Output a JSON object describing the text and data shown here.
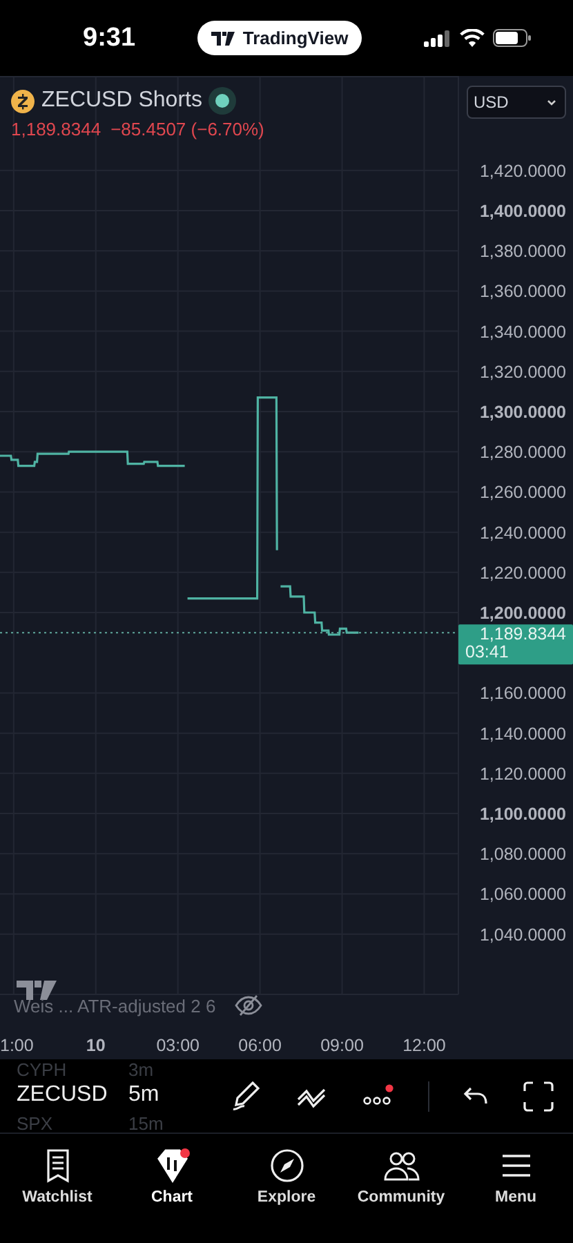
{
  "status_bar": {
    "time": "9:31",
    "app_pill": "TradingView"
  },
  "header": {
    "symbol": "ZECUSD Shorts",
    "last": "1,189.8344",
    "change": "−85.4507 (−6.70%)",
    "currency": "USD"
  },
  "price_tag": {
    "price": "1,189.8344",
    "countdown": "03:41"
  },
  "indicator": {
    "label": "Weis ... ATR-adjusted 2 6"
  },
  "time_axis": [
    "1:00",
    "10"
  ],
  "chart_data": {
    "type": "line",
    "grid": true,
    "ylim": [
      1010,
      1467
    ],
    "xlim": [
      -3.5,
      13.25
    ],
    "xticks": [
      {
        "value": 3,
        "label": "03:00"
      },
      {
        "value": 6,
        "label": "06:00"
      },
      {
        "value": 9,
        "label": "09:00"
      },
      {
        "value": 12,
        "label": "12:00"
      }
    ],
    "x": [
      -3.5,
      -3.1,
      -3.08,
      -2.85,
      -2.83,
      -2.25,
      -2.23,
      -2.15,
      -2.13,
      -1,
      -0.98,
      1.15,
      1.17,
      1.75,
      1.77,
      2.25,
      2.27,
      3.25,
      3.3,
      3.35,
      5.9,
      5.92,
      6.6,
      6.62,
      6.7,
      6.75,
      7.1,
      7.12,
      7.6,
      7.62,
      8,
      8.02,
      8.25,
      8.27,
      8.5,
      8.52,
      8.9,
      8.92,
      9.15,
      9.17,
      9.6,
      13.25
    ],
    "series": [
      {
        "color": "#4fb3a3",
        "values": [
          1278,
          1278,
          1276,
          1276,
          1273,
          1273,
          1275,
          1275,
          1279,
          1279,
          1280,
          1280,
          1274,
          1274,
          1275,
          1275,
          1273,
          1273,
          null,
          1207,
          1207,
          1307,
          1307,
          1231,
          null,
          1213,
          1213,
          1208,
          1208,
          1200,
          1200,
          1195,
          1195,
          1191,
          1191,
          1189,
          1189,
          1192,
          1192,
          1190,
          1190,
          null
        ]
      },
      {
        "color": "#5fa89c",
        "line_style": "dotted",
        "values": [
          1190,
          1190,
          1190,
          1190,
          1190,
          1190,
          1190,
          1190,
          1190,
          1190,
          1190,
          1190,
          1190,
          1190,
          1190,
          1190,
          1190,
          1190,
          1190,
          1190,
          1190,
          1190,
          1190,
          1190,
          1190,
          1190,
          1190,
          1190,
          1190,
          1190,
          1190,
          1190,
          1190,
          1190,
          1190,
          1190,
          1190,
          1190,
          1190,
          1190,
          1190,
          1190
        ]
      }
    ],
    "yticks": [
      {
        "value": 1420,
        "label": "1,420.0000"
      },
      {
        "value": 1400,
        "label": "1,400.0000"
      },
      {
        "value": 1380,
        "label": "1,380.0000"
      },
      {
        "value": 1360,
        "label": "1,360.0000"
      },
      {
        "value": 1340,
        "label": "1,340.0000"
      },
      {
        "value": 1320,
        "label": "1,320.0000"
      },
      {
        "value": 1300,
        "label": "1,300.0000"
      },
      {
        "value": 1280,
        "label": "1,280.0000"
      },
      {
        "value": 1260,
        "label": "1,260.0000"
      },
      {
        "value": 1240,
        "label": "1,240.0000"
      },
      {
        "value": 1220,
        "label": "1,220.0000"
      },
      {
        "value": 1200,
        "label": "1,200.0000"
      },
      {
        "value": 1160,
        "label": "1,160.0000"
      },
      {
        "value": 1140,
        "label": "1,140.0000"
      },
      {
        "value": 1120,
        "label": "1,120.0000"
      },
      {
        "value": 1100,
        "label": "1,100.0000"
      },
      {
        "value": 1080,
        "label": "1,080.0000"
      },
      {
        "value": 1060,
        "label": "1,060.0000"
      },
      {
        "value": 1040,
        "label": "1,040.0000"
      }
    ]
  },
  "toolbar": {
    "symbol": "ZECUSD",
    "interval": "5m",
    "prev_symbol": "CYPH",
    "prev_interval": "3m",
    "next_symbol": "SPX",
    "next_interval": "15m",
    "more_badge": true
  },
  "nav": [
    {
      "label": "Watchlist",
      "selected": false,
      "badge": false
    },
    {
      "label": "Chart",
      "selected": true,
      "badge": true
    },
    {
      "label": "Explore",
      "selected": false,
      "badge": false
    },
    {
      "label": "Community",
      "selected": false,
      "badge": false
    },
    {
      "label": "Menu",
      "selected": false,
      "badge": false
    }
  ]
}
